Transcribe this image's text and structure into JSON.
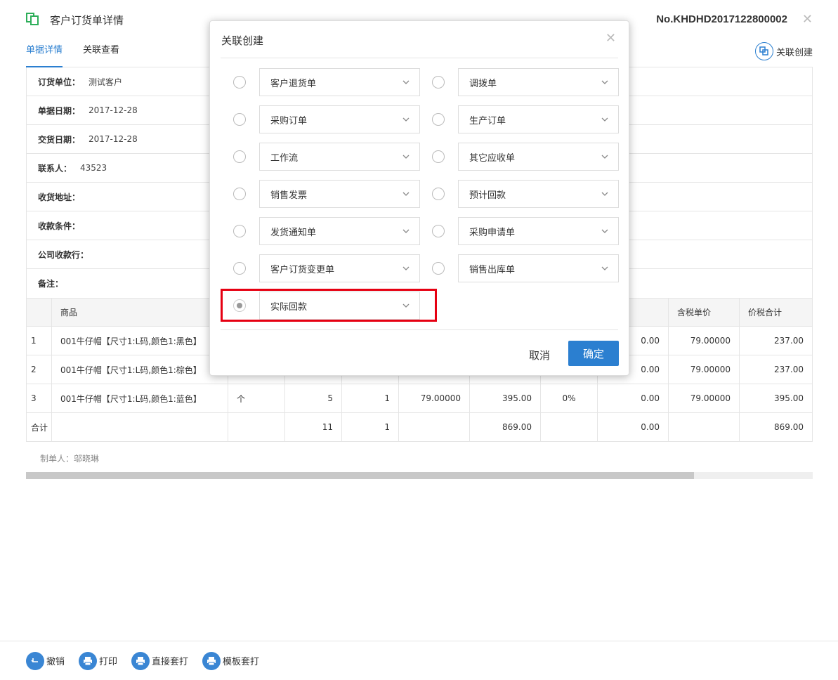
{
  "header": {
    "title": "客户订货单详情",
    "doc_no": "No.KHDHD2017122800002",
    "close_icon": "close-icon"
  },
  "tabs": [
    {
      "label": "单据详情",
      "active": true
    },
    {
      "label": "关联查看",
      "active": false
    }
  ],
  "link_create": "关联创建",
  "info": [
    {
      "label": "订货单位：",
      "value": "测试客户"
    },
    {
      "label": "单据日期：",
      "value": "2017-12-28"
    },
    {
      "label": "交货日期：",
      "value": "2017-12-28"
    },
    {
      "label": "联系人：",
      "value": "43523"
    },
    {
      "label": "收货地址：",
      "value": ""
    },
    {
      "label": "收款条件：",
      "value": ""
    },
    {
      "label": "公司收款行：",
      "value": ""
    },
    {
      "label": "备注：",
      "value": ""
    }
  ],
  "table": {
    "headers": [
      "",
      "商品",
      "",
      "",
      "",
      "",
      "",
      "",
      "含税单价",
      "价税合计"
    ],
    "rows": [
      [
        "1",
        "001牛仔帽【尺寸1:L码,颜色1:黑色】",
        "",
        "",
        "",
        "",
        "",
        "0.00",
        "79.00000",
        "237.00"
      ],
      [
        "2",
        "001牛仔帽【尺寸1:L码,颜色1:棕色】",
        "",
        "",
        "",
        "",
        "",
        "0.00",
        "79.00000",
        "237.00"
      ],
      [
        "3",
        "001牛仔帽【尺寸1:L码,颜色1:蓝色】",
        "个",
        "5",
        "1",
        "79.00000",
        "395.00",
        "0%",
        "0.00",
        "79.00000",
        "395.00"
      ]
    ],
    "total": [
      "合计",
      "",
      "",
      "11",
      "1",
      "",
      "869.00",
      "",
      "0.00",
      "",
      "869.00"
    ]
  },
  "maker": "制单人：邬晓琳",
  "footer": [
    {
      "label": "撤销",
      "icon": "undo-icon"
    },
    {
      "label": "打印",
      "icon": "printer-icon"
    },
    {
      "label": "直接套打",
      "icon": "printer-icon"
    },
    {
      "label": "模板套打",
      "icon": "printer-icon"
    }
  ],
  "modal": {
    "title": "关联创建",
    "options": [
      {
        "label": "客户退货单"
      },
      {
        "label": "调拨单"
      },
      {
        "label": "采购订单"
      },
      {
        "label": "生产订单"
      },
      {
        "label": "工作流"
      },
      {
        "label": "其它应收单"
      },
      {
        "label": "销售发票"
      },
      {
        "label": "预计回款"
      },
      {
        "label": "发货通知单"
      },
      {
        "label": "采购申请单"
      },
      {
        "label": "客户订货变更单"
      },
      {
        "label": "销售出库单"
      },
      {
        "label": "实际回款",
        "selected": true
      }
    ],
    "cancel": "取消",
    "ok": "确定"
  },
  "colors": {
    "accent": "#2b7fd0",
    "highlight": "#e60012"
  }
}
